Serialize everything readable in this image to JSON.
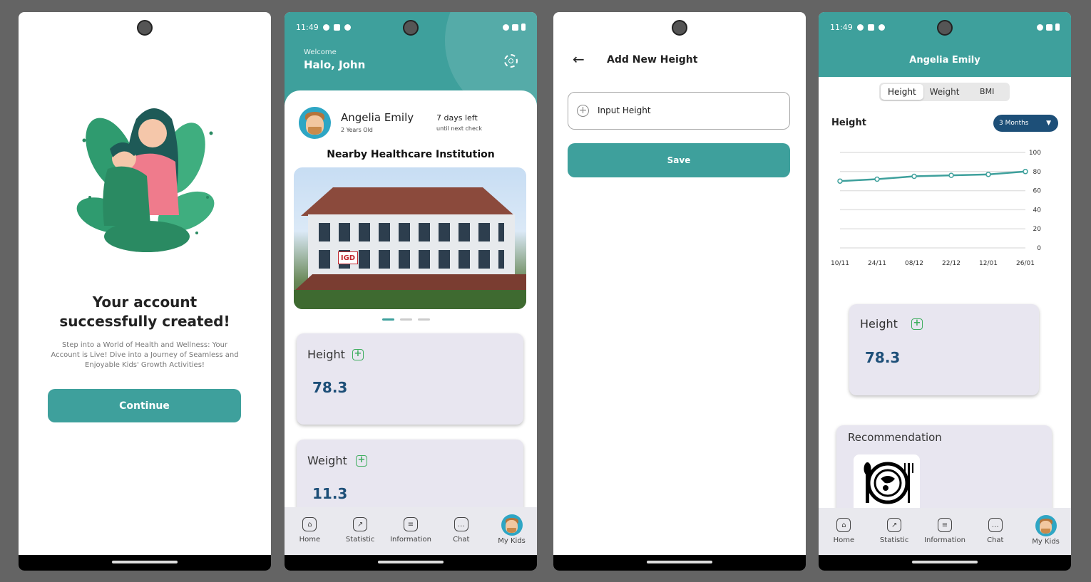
{
  "screen1": {
    "title_line1": "Your account",
    "title_line2": "successfully created!",
    "description": "Step into a World of Health and Wellness: Your Account is Live! Dive into a Journey of Seamless and Enjoyable Kids' Growth Activities!",
    "continue_label": "Continue"
  },
  "screen2": {
    "status_time": "11:49",
    "welcome": "Welcome",
    "greeting": "Halo, John",
    "child_name": "Angelia Emily",
    "child_age": "2 Years Old",
    "days_left": "7 days left",
    "until_check": "until next check",
    "section_title": "Nearby Healthcare Institution",
    "sign_text": "IGD",
    "carousel": {
      "count": 3,
      "active": 0
    },
    "height_label": "Height",
    "height_value": "78.3",
    "weight_label": "Weight",
    "weight_value": "11.3"
  },
  "screen3": {
    "title": "Add New Height",
    "input_placeholder": "Input Height",
    "save_label": "Save"
  },
  "screen4": {
    "status_time": "11:49",
    "header_title": "Angelia Emily",
    "tabs": [
      "Height",
      "Weight",
      "BMI"
    ],
    "active_tab": "Height",
    "chart_title": "Height",
    "period": "3 Months",
    "height_label": "Height",
    "height_value": "78.3",
    "recommendation": "Recommendation"
  },
  "bottom_nav": {
    "home": "Home",
    "statistic": "Statistic",
    "information": "Information",
    "chat": "Chat",
    "my_kids": "My Kids"
  },
  "colors": {
    "primary": "#3ea09c",
    "value_text": "#1d4f78",
    "card_bg": "#e8e6f0",
    "add_green": "#3fae5f"
  },
  "chart_data": {
    "type": "line",
    "x": [
      "10/11",
      "24/11",
      "08/12",
      "22/12",
      "12/01",
      "26/01"
    ],
    "series": [
      {
        "values": [
          70,
          72,
          75,
          76,
          77,
          80
        ]
      }
    ],
    "yticks": [
      0,
      20,
      40,
      60,
      80,
      100
    ],
    "ylim": [
      0,
      100
    ],
    "grid": true
  }
}
